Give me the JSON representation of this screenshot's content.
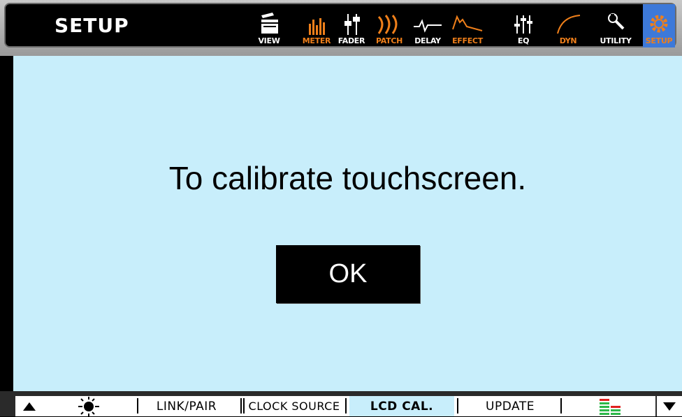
{
  "header": {
    "title": "SETUP",
    "nav": [
      {
        "label": "VIEW",
        "icon": "view-icon",
        "color": "#ffffff"
      },
      {
        "label": "METER",
        "icon": "meter-icon",
        "color": "#ef7f1a"
      },
      {
        "label": "FADER",
        "icon": "fader-icon",
        "color": "#ffffff"
      },
      {
        "label": "PATCH",
        "icon": "patch-icon",
        "color": "#ef7f1a"
      },
      {
        "label": "DELAY",
        "icon": "delay-icon",
        "color": "#ffffff"
      },
      {
        "label": "EFFECT",
        "icon": "effect-icon",
        "color": "#ef7f1a"
      },
      {
        "label": "EQ",
        "icon": "eq-icon",
        "color": "#ffffff"
      },
      {
        "label": "DYN",
        "icon": "dyn-icon",
        "color": "#ef7f1a"
      },
      {
        "label": "UTILITY",
        "icon": "utility-icon",
        "color": "#ffffff"
      },
      {
        "label": "SETUP",
        "icon": "setup-gear-icon",
        "color": "#ef7f1a",
        "active": true
      }
    ]
  },
  "dialog": {
    "message": "To calibrate touchscreen.",
    "ok_label": "OK"
  },
  "footer": {
    "tabs": [
      {
        "label": "LINK/PAIR"
      },
      {
        "label": "CLOCK SOURCE"
      },
      {
        "label": "LCD CAL.",
        "active": true
      },
      {
        "label": "UPDATE"
      }
    ],
    "icons": [
      "scroll-up-icon",
      "brightness-icon",
      "level-meter-icon",
      "scroll-down-icon"
    ]
  },
  "colors": {
    "background": "#000000",
    "panel": "#c8eefb",
    "accent_orange": "#ef7f1a",
    "active_blue": "#3d79d9"
  }
}
